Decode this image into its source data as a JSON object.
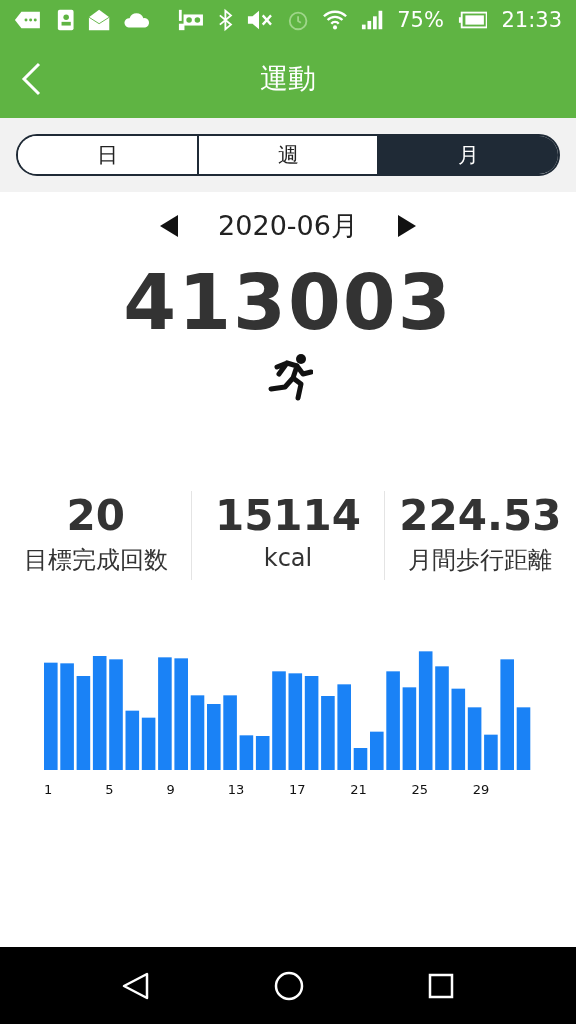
{
  "status_bar": {
    "battery": "75%",
    "time": "21:33"
  },
  "header": {
    "title": "運動"
  },
  "tabs": [
    {
      "label": "日",
      "selected": false
    },
    {
      "label": "週",
      "selected": false
    },
    {
      "label": "月",
      "selected": true
    }
  ],
  "period": "2020-06月",
  "total_steps": "413003",
  "stats": [
    {
      "value": "20",
      "label": "目標完成回数"
    },
    {
      "value": "15114",
      "label": "kcal"
    },
    {
      "value": "224.53",
      "label": "月間歩行距離"
    }
  ],
  "chart_labels": [
    "1",
    "5",
    "9",
    "13",
    "17",
    "21",
    "25",
    "29"
  ]
}
